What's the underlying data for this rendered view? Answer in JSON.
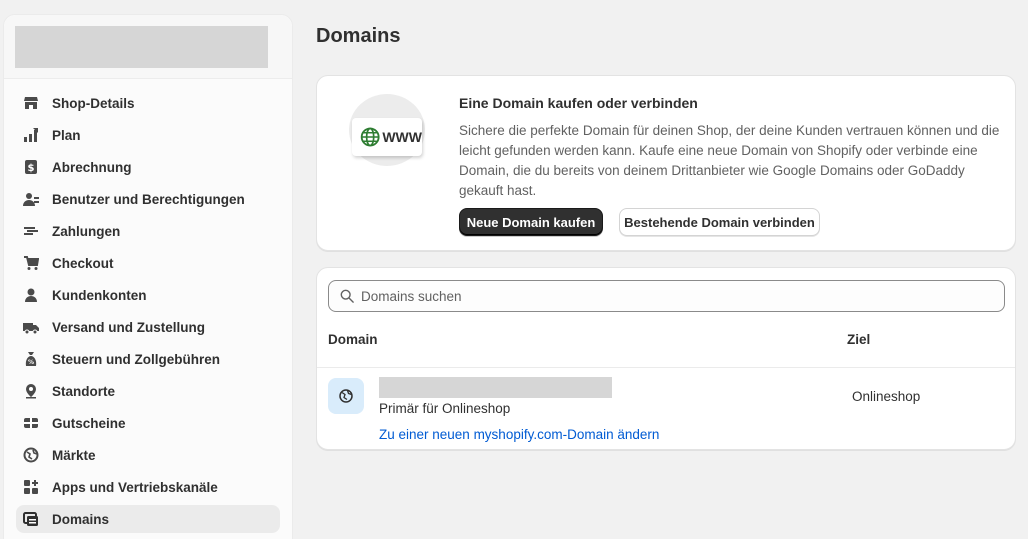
{
  "page": {
    "title": "Domains"
  },
  "sidebar": {
    "items": [
      {
        "label": "Shop-Details",
        "icon": "store-icon"
      },
      {
        "label": "Plan",
        "icon": "plan-icon"
      },
      {
        "label": "Abrechnung",
        "icon": "billing-icon"
      },
      {
        "label": "Benutzer und Berechtigungen",
        "icon": "users-icon"
      },
      {
        "label": "Zahlungen",
        "icon": "payments-icon"
      },
      {
        "label": "Checkout",
        "icon": "cart-icon"
      },
      {
        "label": "Kundenkonten",
        "icon": "person-icon"
      },
      {
        "label": "Versand und Zustellung",
        "icon": "truck-icon"
      },
      {
        "label": "Steuern und Zollgebühren",
        "icon": "tax-bag-icon"
      },
      {
        "label": "Standorte",
        "icon": "location-pin-icon"
      },
      {
        "label": "Gutscheine",
        "icon": "gift-card-icon"
      },
      {
        "label": "Märkte",
        "icon": "globe-markets-icon"
      },
      {
        "label": "Apps und Vertriebskanäle",
        "icon": "apps-icon"
      },
      {
        "label": "Domains",
        "icon": "domains-icon",
        "active": true
      }
    ]
  },
  "buy_card": {
    "illustration_text": "WWW",
    "title": "Eine Domain kaufen oder verbinden",
    "description": "Sichere die perfekte Domain für deinen Shop, der deine Kunden vertrauen können und die leicht gefunden werden kann. Kaufe eine neue Domain von Shopify oder verbinde eine Domain, die du bereits von deinem Drittanbieter wie Google Domains oder GoDaddy gekauft hast.",
    "primary_button": "Neue Domain kaufen",
    "secondary_button": "Bestehende Domain verbinden"
  },
  "domains_card": {
    "search_placeholder": "Domains suchen",
    "search_value": "",
    "columns": {
      "domain": "Domain",
      "target": "Ziel"
    },
    "rows": [
      {
        "primary_label": "Primär für Onlineshop",
        "change_link": "Zu einer neuen myshopify.com-Domain ändern",
        "target": "Onlineshop"
      }
    ]
  },
  "colors": {
    "primary_button_bg": "#303030",
    "link": "#005bd3",
    "domain_icon_bg": "#d9ecfb",
    "globe_green": "#2e7d32"
  }
}
